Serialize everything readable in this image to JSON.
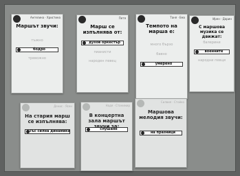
{
  "cards": [
    {
      "tag": "Ангелина · Христина",
      "question": "Маршът звучи:",
      "options": [
        "тъжно",
        "бодро",
        "тревожно"
      ],
      "selected": 1
    },
    {
      "tag": "Петя",
      "question": "Марш се изпълнява от:",
      "options": [
        "духов оркестър",
        "пианисти",
        "народен певец"
      ],
      "selected": 0
    },
    {
      "tag": "Таня · Ема",
      "question": "Темпото на марша е:",
      "options": [
        "много бързо",
        "бавно",
        "умерено"
      ],
      "selected": 2
    },
    {
      "tag": "Ирен · Дарин",
      "question": "С маршова музика се движат:",
      "options": [
        "балерини",
        "военните",
        "народни певци"
      ],
      "selected": 1
    },
    {
      "tag": "Денис · Ясен",
      "question": "На стария марш се изпълнява:",
      "options": [
        "със силна динамика",
        "",
        ""
      ],
      "selected": 0
    },
    {
      "tag": "Надя · Станимир",
      "question": "В концертна зала маршът звучи за:",
      "options": [
        "слушане",
        "",
        ""
      ],
      "selected": 0
    },
    {
      "tag": "Силвия · Стойко",
      "question": "Маршова мелодия звучи:",
      "options": [
        "",
        "на празници",
        ""
      ],
      "selected": 1
    }
  ]
}
